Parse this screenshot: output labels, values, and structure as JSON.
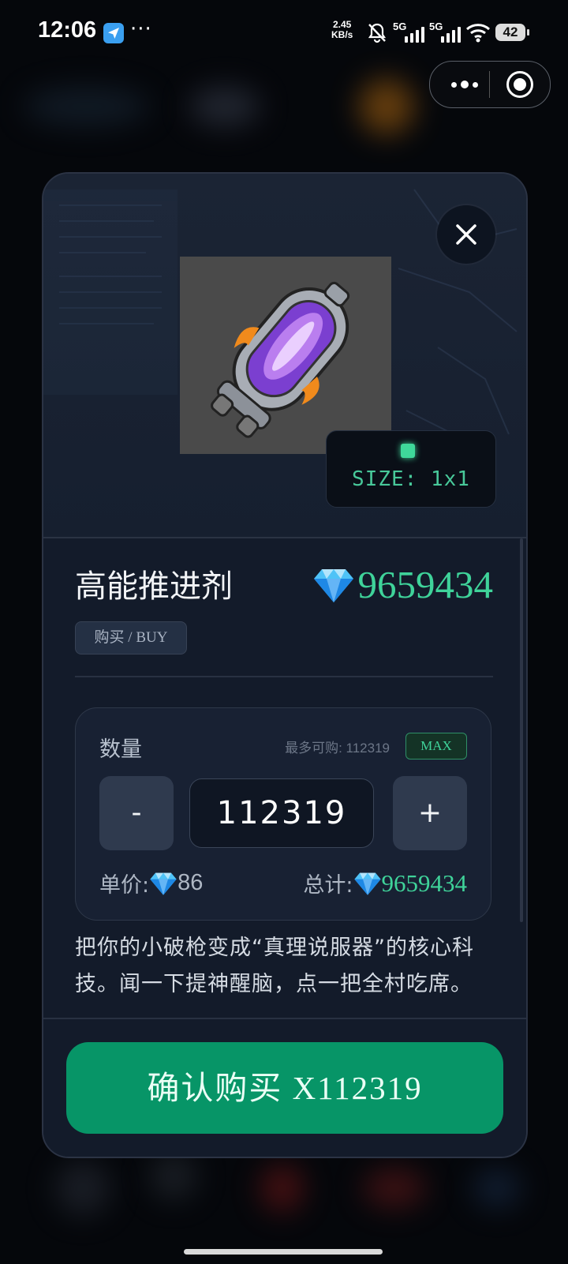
{
  "status_bar": {
    "time": "12:06",
    "more": "···",
    "net_speed": "2.45",
    "net_unit": "KB/s",
    "sim1": "5G",
    "sim2": "5G",
    "battery": "42"
  },
  "product": {
    "name": "高能推进剂",
    "price": "9659434",
    "buy_tag": "购买 / BUY",
    "size": "SIZE: 1x1"
  },
  "quantity": {
    "label": "数量",
    "max_buy": "最多可购: 112319",
    "max_button": "MAX",
    "minus": "-",
    "plus": "+",
    "value": "112319",
    "unit_price_label": "单价: ",
    "unit_price": "86",
    "total_label": "总计: ",
    "total": "9659434"
  },
  "description": "把你的小破枪变成“真理说服器”的核心科技。闻一下提神醒脑，点一把全村吃席。",
  "confirm_button": "确认购买 X112319",
  "colors": {
    "accent_green": "#3fd39a",
    "confirm_bg": "#079567",
    "modal_bg": "#131b2a"
  },
  "icons": [
    "gem-icon",
    "close-icon",
    "capsule-more-icon",
    "capsule-target-icon",
    "propellant-item-icon"
  ]
}
